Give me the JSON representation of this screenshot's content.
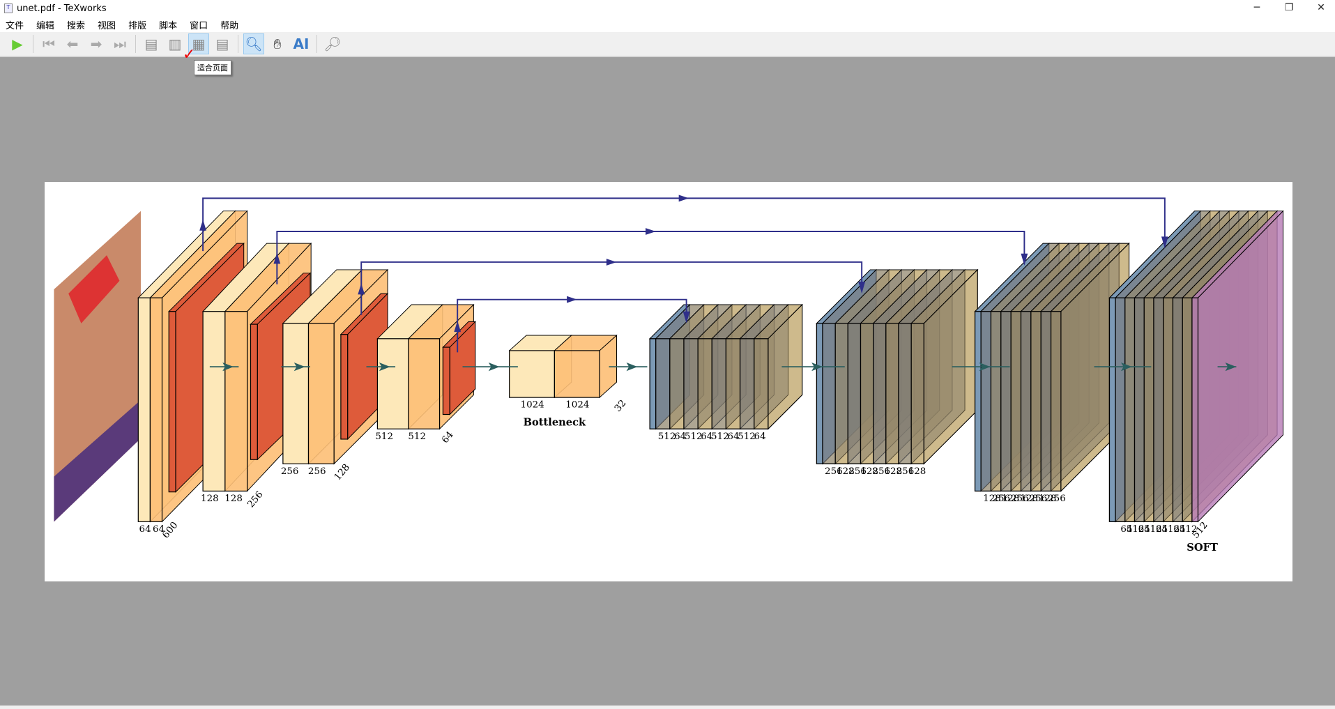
{
  "window": {
    "title": "unet.pdf - TeXworks",
    "minimize": "─",
    "restore": "❐",
    "close": "✕"
  },
  "menu": [
    "文件",
    "编辑",
    "搜索",
    "视图",
    "排版",
    "脚本",
    "窗口",
    "帮助"
  ],
  "toolbar": {
    "tooltip": "适合页面",
    "active_tool": "magnifier",
    "icons": [
      "typeset-icon",
      "first-page-icon",
      "previous-page-icon",
      "next-page-icon",
      "last-page-icon",
      "actual-size-icon",
      "fit-width-icon",
      "fit-page-icon",
      "fit-content-icon",
      "magnifier-icon",
      "hand-icon",
      "text-select-icon",
      "find-icon"
    ]
  },
  "diagram": {
    "encoder": [
      {
        "labels": [
          "64",
          "64",
          "600"
        ]
      },
      {
        "labels": [
          "128",
          "128",
          "256"
        ]
      },
      {
        "labels": [
          "256",
          "256",
          "128"
        ]
      },
      {
        "labels": [
          "512",
          "512",
          "64"
        ]
      }
    ],
    "bottleneck": {
      "labels": [
        "1024",
        "1024",
        "32"
      ],
      "caption": "Bottleneck"
    },
    "decoder": [
      {
        "labels": [
          "512",
          "64",
          "512",
          "64",
          "512",
          "64",
          "512",
          "64"
        ]
      },
      {
        "labels": [
          "256",
          "128",
          "256",
          "128",
          "256",
          "128",
          "256",
          "128"
        ]
      },
      {
        "labels": [
          "128",
          "256",
          "128",
          "256",
          "128",
          "256",
          "128",
          "256"
        ]
      },
      {
        "labels": [
          "64",
          "512",
          "64",
          "512",
          "64",
          "512",
          "64",
          "512"
        ]
      }
    ],
    "softmax": {
      "labels": [
        "512"
      ],
      "caption": "SOFT"
    },
    "colors": {
      "conv": "#fde8b9",
      "relu": "#fdbf76",
      "pool": "#de5b3a",
      "unpool": "#5b86b5",
      "concat": "#7a7a7a",
      "output": "#b77bb5",
      "arrow": "#2f2f8a",
      "connection": "#2b5f5f"
    }
  }
}
